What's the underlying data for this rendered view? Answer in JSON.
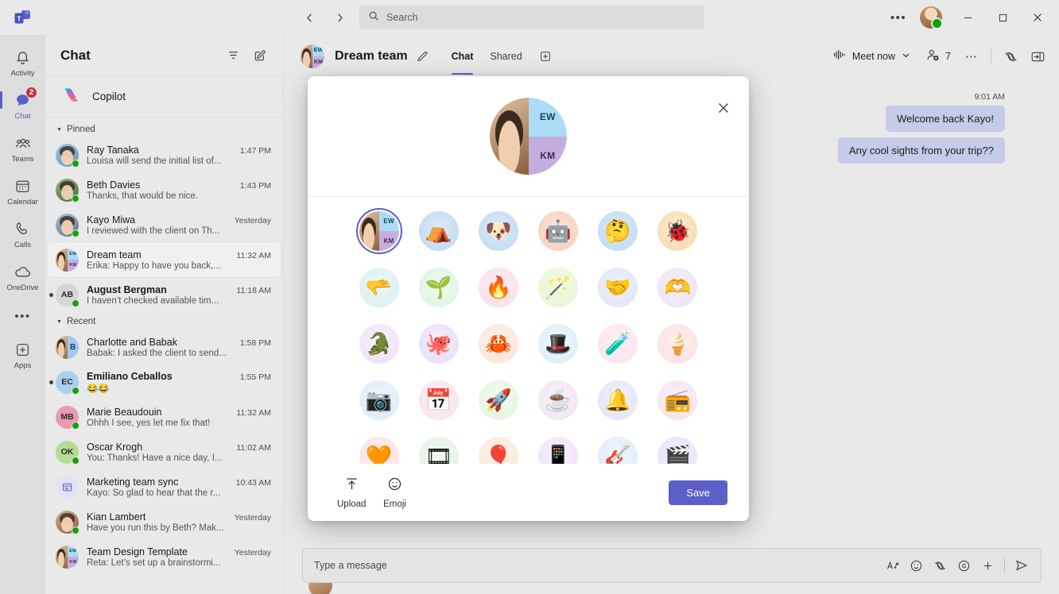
{
  "titlebar": {
    "logo_icon": "teams-logo-icon",
    "back_icon": "chevron-left-icon",
    "forward_icon": "chevron-right-icon",
    "search_placeholder": "Search",
    "search_icon": "search-icon",
    "more_label": "•••",
    "minimize_label": "─",
    "maximize_label": "□",
    "close_label": "✕"
  },
  "rail": {
    "items": [
      {
        "label": "Activity",
        "icon": "bell-icon",
        "active": false,
        "badge": ""
      },
      {
        "label": "Chat",
        "icon": "chat-icon",
        "active": true,
        "badge": "2"
      },
      {
        "label": "Teams",
        "icon": "teams-people-icon",
        "active": false,
        "badge": ""
      },
      {
        "label": "Calendar",
        "icon": "calendar-icon",
        "active": false,
        "badge": ""
      },
      {
        "label": "Calls",
        "icon": "phone-icon",
        "active": false,
        "badge": ""
      },
      {
        "label": "OneDrive",
        "icon": "cloud-icon",
        "active": false,
        "badge": ""
      }
    ],
    "more_label": "•••",
    "apps": {
      "label": "Apps",
      "icon": "apps-plus-icon"
    }
  },
  "chat_pane": {
    "title": "Chat",
    "filter_icon": "filter-icon",
    "compose_icon": "new-chat-icon",
    "copilot": {
      "label": "Copilot",
      "icon": "copilot-icon"
    },
    "groups": [
      {
        "label": "Pinned",
        "items": [
          {
            "name": "Ray Tanaka",
            "preview": "Louisa will send the initial list of...",
            "time": "1:47 PM",
            "avatar": "photo",
            "color1": "#9ec7e8",
            "color2": "#6d90b0",
            "initials": "",
            "presence": "available",
            "unread": false,
            "selected": false
          },
          {
            "name": "Beth Davies",
            "preview": "Thanks, that would be nice.",
            "time": "1:43 PM",
            "avatar": "photo",
            "color1": "#8fb77a",
            "color2": "#4b6b3c",
            "initials": "",
            "presence": "available",
            "unread": false,
            "selected": false
          },
          {
            "name": "Kayo Miwa",
            "preview": "I reviewed with the client on Th...",
            "time": "Yesterday",
            "avatar": "photo",
            "color1": "#a8c4d8",
            "color2": "#5c7284",
            "initials": "",
            "presence": "available",
            "unread": false,
            "selected": false
          },
          {
            "name": "Dream team",
            "preview": "Erika: Happy to have you back,...",
            "time": "11:32 AM",
            "avatar": "team",
            "color1": "#aadcf5",
            "color2": "#c4aedd",
            "initials": "",
            "presence": "none",
            "unread": false,
            "selected": true
          },
          {
            "name": "August Bergman",
            "preview": "I haven’t checked available tim...",
            "time": "11:18 AM",
            "avatar": "initials",
            "color1": "#d6d6d6",
            "color2": "#d6d6d6",
            "initials": "AB",
            "presence": "available",
            "unread": true,
            "selected": false
          }
        ]
      },
      {
        "label": "Recent",
        "items": [
          {
            "name": "Charlotte and Babak",
            "preview": "Babak: I asked the client to send...",
            "time": "1:58 PM",
            "avatar": "split",
            "color1": "#e6c59c",
            "color2": "#a3c7f0",
            "initials": "B",
            "presence": "none",
            "unread": false,
            "selected": false
          },
          {
            "name": "Emiliano Ceballos",
            "preview": "😂😂",
            "time": "1:55 PM",
            "avatar": "initials",
            "color1": "#a8d1f0",
            "color2": "#a8d1f0",
            "initials": "EC",
            "presence": "available",
            "unread": true,
            "selected": false
          },
          {
            "name": "Marie Beaudouin",
            "preview": "Ohhh I see, yes let me fix that!",
            "time": "11:32 AM",
            "avatar": "initials",
            "color1": "#e79ab0",
            "color2": "#e79ab0",
            "initials": "MB",
            "presence": "available",
            "unread": false,
            "selected": false
          },
          {
            "name": "Oscar Krogh",
            "preview": "You: Thanks! Have a nice day, I...",
            "time": "11:02 AM",
            "avatar": "initials",
            "color1": "#b5dc93",
            "color2": "#b5dc93",
            "initials": "OK",
            "presence": "available",
            "unread": false,
            "selected": false
          },
          {
            "name": "Marketing team sync",
            "preview": "Kayo: So glad to hear that the r...",
            "time": "10:43 AM",
            "avatar": "icon",
            "color1": "#e4e2f8",
            "color2": "#e4e2f8",
            "initials": "",
            "presence": "none",
            "unread": false,
            "selected": false
          },
          {
            "name": "Kian Lambert",
            "preview": "Have you run this by Beth? Mak...",
            "time": "Yesterday",
            "avatar": "photo",
            "color1": "#d8b191",
            "color2": "#8a5c3c",
            "initials": "",
            "presence": "available",
            "unread": false,
            "selected": false
          },
          {
            "name": "Team Design Template",
            "preview": "Reta: Let’s set up a brainstormi...",
            "time": "Yesterday",
            "avatar": "team",
            "color1": "#aadcf5",
            "color2": "#c4aedd",
            "initials": "",
            "presence": "none",
            "unread": false,
            "selected": false
          }
        ]
      }
    ]
  },
  "chat_header": {
    "title": "Dream team",
    "edit_icon": "pencil-icon",
    "tabs": [
      {
        "label": "Chat",
        "active": true
      },
      {
        "label": "Shared",
        "active": false
      }
    ],
    "add_tab_icon": "add-tab-icon",
    "meet_now": {
      "label": "Meet now",
      "icon": "meet-now-icon",
      "chevron": "chevron-down-icon"
    },
    "participants": {
      "count": "7",
      "icon": "add-people-icon"
    },
    "more_icon": "more-options-icon",
    "copilot_icon": "copilot-icon",
    "panel_icon": "open-side-panel-icon"
  },
  "conversation": {
    "timestamp": "9:01 AM",
    "messages": [
      {
        "text": "Welcome back Kayo!"
      },
      {
        "text": "Any cool sights from your trip??"
      }
    ]
  },
  "compose": {
    "placeholder": "Type a message",
    "format_icon": "format-text-icon",
    "emoji_icon": "emoji-icon",
    "copilot_icon": "copilot-icon",
    "giphy_icon": "giphy-icon",
    "plus_icon": "add-attachment-icon",
    "send_icon": "send-icon"
  },
  "modal": {
    "close_icon": "close-icon",
    "current_avatar": {
      "initials_top": "EW",
      "initials_bottom": "KM"
    },
    "avatars": [
      {
        "name": "current-team-avatar",
        "glyph": "",
        "bg1": "#aadcf5",
        "bg2": "#c4aedd",
        "kind": "team",
        "selected": true
      },
      {
        "name": "camping-avatar",
        "glyph": "⛺",
        "bg1": "#bcd9f2",
        "bg2": "#d9e9f7",
        "kind": "glyph",
        "selected": false
      },
      {
        "name": "dog-avatar",
        "glyph": "🐶",
        "bg1": "#bcd9f2",
        "bg2": "#dce9f6",
        "kind": "glyph",
        "selected": false
      },
      {
        "name": "robot-avatar",
        "glyph": "🤖",
        "bg1": "#f7cdbd",
        "bg2": "#fbe3d7",
        "kind": "glyph",
        "selected": false
      },
      {
        "name": "thinking-face-avatar",
        "glyph": "🤔",
        "bg1": "#bcd9f2",
        "bg2": "#dde9f7",
        "kind": "glyph",
        "selected": false
      },
      {
        "name": "bug-avatar",
        "glyph": "🐞",
        "bg1": "#f7d9a8",
        "bg2": "#fbead0",
        "kind": "glyph",
        "selected": false
      },
      {
        "name": "hands-stacked-avatar",
        "glyph": "🫳",
        "bg1": "#d6eef0",
        "bg2": "#ecf7f8",
        "kind": "glyph",
        "selected": false
      },
      {
        "name": "leaf-in-hand-avatar",
        "glyph": "🌱",
        "bg1": "#dcf3e0",
        "bg2": "#eefaf0",
        "kind": "glyph",
        "selected": false
      },
      {
        "name": "hands-holding-flame-avatar",
        "glyph": "🔥",
        "bg1": "#fbdce6",
        "bg2": "#fdeef3",
        "kind": "glyph",
        "selected": false
      },
      {
        "name": "magic-wand-avatar",
        "glyph": "🪄",
        "bg1": "#e6f5cf",
        "bg2": "#f3fae6",
        "kind": "glyph",
        "selected": false
      },
      {
        "name": "handshake-avatar",
        "glyph": "🤝",
        "bg1": "#dfe3f8",
        "bg2": "#eff1fc",
        "kind": "glyph",
        "selected": false
      },
      {
        "name": "heart-hands-avatar",
        "glyph": "🫶",
        "bg1": "#ece0f5",
        "bg2": "#f6f0fa",
        "kind": "glyph",
        "selected": false
      },
      {
        "name": "monster-crocodile-avatar",
        "glyph": "🐊",
        "bg1": "#ecdff7",
        "bg2": "#f6f0fb",
        "kind": "glyph",
        "selected": false
      },
      {
        "name": "monster-octopus-avatar",
        "glyph": "🐙",
        "bg1": "#e6ddf7",
        "bg2": "#f3eefb",
        "kind": "glyph",
        "selected": false
      },
      {
        "name": "monster-crab-avatar",
        "glyph": "🦀",
        "bg1": "#fbe4d6",
        "bg2": "#fdf1e9",
        "kind": "glyph",
        "selected": false
      },
      {
        "name": "monster-bunny-hat-avatar",
        "glyph": "🎩",
        "bg1": "#d6eef8",
        "bg2": "#ecf7fc",
        "kind": "glyph",
        "selected": false
      },
      {
        "name": "monster-potion-avatar",
        "glyph": "🧪",
        "bg1": "#fbe1ea",
        "bg2": "#fdf1f5",
        "kind": "glyph",
        "selected": false
      },
      {
        "name": "monster-icecream-avatar",
        "glyph": "🍦",
        "bg1": "#fbdede",
        "bg2": "#fdefef",
        "kind": "glyph",
        "selected": false
      },
      {
        "name": "camera-avatar",
        "glyph": "📷",
        "bg1": "#dceaf8",
        "bg2": "#eef4fc",
        "kind": "glyph",
        "selected": false
      },
      {
        "name": "calendar-avatar",
        "glyph": "📅",
        "bg1": "#f6e2ea",
        "bg2": "#fbf1f5",
        "kind": "glyph",
        "selected": false
      },
      {
        "name": "rocket-avatar",
        "glyph": "🚀",
        "bg1": "#e2f3dd",
        "bg2": "#f1faee",
        "kind": "glyph",
        "selected": false
      },
      {
        "name": "teacup-avatar",
        "glyph": "☕",
        "bg1": "#f2e4f0",
        "bg2": "#f9f1f8",
        "kind": "glyph",
        "selected": false
      },
      {
        "name": "bell-avatar",
        "glyph": "🔔",
        "bg1": "#e0e2f7",
        "bg2": "#f0f1fc",
        "kind": "glyph",
        "selected": false
      },
      {
        "name": "boombox-avatar",
        "glyph": "📻",
        "bg1": "#f4e0ee",
        "bg2": "#fbf0f7",
        "kind": "glyph",
        "selected": false
      },
      {
        "name": "heart-avatar",
        "glyph": "🧡",
        "bg1": "#fbdedd",
        "bg2": "#fdefee",
        "kind": "glyph",
        "selected": false
      },
      {
        "name": "film-reel-avatar",
        "glyph": "🎞",
        "bg1": "#e2f1e2",
        "bg2": "#f1f9f1",
        "kind": "glyph",
        "selected": false
      },
      {
        "name": "hot-air-balloon-avatar",
        "glyph": "🎈",
        "bg1": "#fbe6d6",
        "bg2": "#fdf3ea",
        "kind": "glyph",
        "selected": false
      },
      {
        "name": "app-window-avatar",
        "glyph": "📱",
        "bg1": "#ece0f6",
        "bg2": "#f6f0fb",
        "kind": "glyph",
        "selected": false
      },
      {
        "name": "guitar-avatar",
        "glyph": "🎸",
        "bg1": "#dceaf8",
        "bg2": "#eef4fc",
        "kind": "glyph",
        "selected": false
      },
      {
        "name": "video-player-avatar",
        "glyph": "🎬",
        "bg1": "#e6e0f6",
        "bg2": "#f2eefb",
        "kind": "glyph",
        "selected": false
      }
    ],
    "upload": {
      "label": "Upload",
      "icon": "upload-icon"
    },
    "emoji": {
      "label": "Emoji",
      "icon": "emoji-icon"
    },
    "save_label": "Save"
  },
  "colors": {
    "accent": "#5b5fc7",
    "badge_red": "#c4314b",
    "presence_green": "#13a10e",
    "bubble": "#c5cbe8"
  }
}
